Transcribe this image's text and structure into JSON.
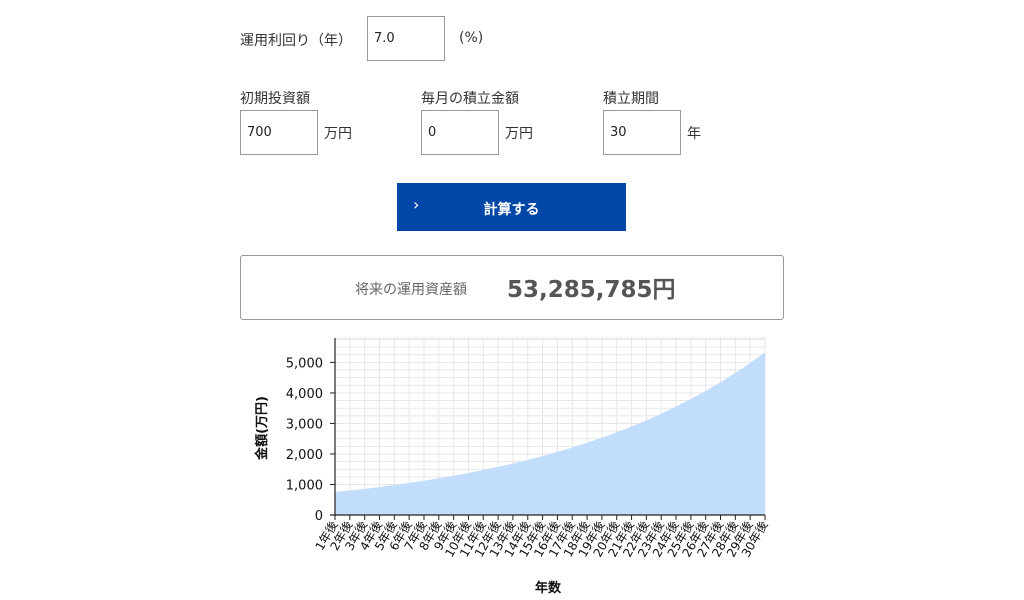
{
  "form": {
    "rate_label": "運用利回り（年）",
    "rate_value": "7.0",
    "rate_unit": "(%)",
    "initial_label": "初期投資額",
    "initial_value": "700",
    "initial_unit": "万円",
    "monthly_label": "毎月の積立金額",
    "monthly_value": "0",
    "monthly_unit": "万円",
    "period_label": "積立期間",
    "period_value": "30",
    "period_unit": "年"
  },
  "button": {
    "label": "計算する",
    "icon": "chevron-right-icon"
  },
  "result": {
    "label": "将来の運用資産額",
    "value": "53,285,785円"
  },
  "chart_data": {
    "type": "area",
    "ylabel": "金額(万円)",
    "xlabel": "年数",
    "ylim": [
      0,
      5800
    ],
    "yticks": [
      0,
      1000,
      2000,
      3000,
      4000,
      5000
    ],
    "ytick_labels": [
      "0",
      "1,000",
      "2,000",
      "3,000",
      "4,000",
      "5,000"
    ],
    "categories": [
      "1年後",
      "2年後",
      "3年後",
      "4年後",
      "5年後",
      "6年後",
      "7年後",
      "8年後",
      "9年後",
      "10年後",
      "11年後",
      "12年後",
      "13年後",
      "14年後",
      "15年後",
      "16年後",
      "17年後",
      "18年後",
      "19年後",
      "20年後",
      "21年後",
      "22年後",
      "23年後",
      "24年後",
      "25年後",
      "26年後",
      "27年後",
      "28年後",
      "29年後",
      "30年後"
    ],
    "values": [
      749,
      801,
      858,
      918,
      982,
      1051,
      1124,
      1203,
      1287,
      1377,
      1473,
      1577,
      1687,
      1805,
      1931,
      2067,
      2211,
      2366,
      2532,
      2709,
      2899,
      3102,
      3319,
      3551,
      3800,
      4066,
      4350,
      4655,
      4981,
      5329
    ],
    "grid": true,
    "fill_color": "#c2ddfb"
  }
}
